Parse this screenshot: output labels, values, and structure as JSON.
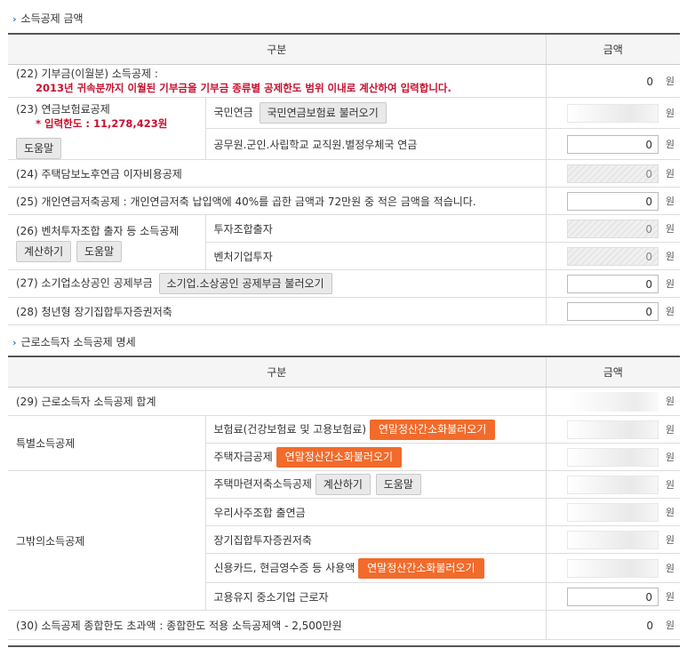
{
  "section1": {
    "title": "소득공제 금액",
    "col_label": "구분",
    "col_amount": "금액",
    "unit": "원",
    "r22": {
      "label": "(22) 기부금(이월분) 소득공제 :",
      "note": "2013년 귀속분까지 이월된 기부금을 기부금 종류별 공제한도 범위 이내로 계산하여 입력합니다.",
      "value": "0"
    },
    "r23": {
      "label": "(23) 연금보험료공제",
      "limit": "* 입력한도 : 11,278,423원",
      "help": "도움말",
      "sub1": "국민연금",
      "sub1_btn": "국민연금보험료 불러오기",
      "sub2": "공무원.군인.사립학교 교직원.별정우체국 연금",
      "sub2_value": "0"
    },
    "r24": {
      "label": "(24) 주택담보노후연금 이자비용공제",
      "value": "0"
    },
    "r25": {
      "label": "(25) 개인연금저축공제 : 개인연금저축 납입액에 40%를 곱한 금액과 72만원 중 적은 금액을 적습니다.",
      "value": "0"
    },
    "r26": {
      "label": "(26) 벤처투자조합 출자 등 소득공제",
      "calc": "계산하기",
      "help": "도움말",
      "sub1": "투자조합출자",
      "sub1_value": "0",
      "sub2": "벤처기업투자",
      "sub2_value": "0"
    },
    "r27": {
      "label": "(27) 소기업소상공인 공제부금",
      "btn": "소기업.소상공인 공제부금 불러오기",
      "value": "0"
    },
    "r28": {
      "label": "(28) 청년형 장기집합투자증권저축",
      "value": "0"
    }
  },
  "section2": {
    "title": "근로소득자 소득공제 명세",
    "col_label": "구분",
    "col_amount": "금액",
    "unit": "원",
    "r29": {
      "label": "(29) 근로소득자 소득공제 합계"
    },
    "special": {
      "label": "특별소득공제",
      "sub1": "보험료(건강보험료 및 고용보험료)",
      "sub1_btn": "연말정산간소화불러오기",
      "sub2": "주택자금공제",
      "sub2_btn": "연말정산간소화불러오기"
    },
    "other": {
      "label": "그밖의소득공제",
      "sub1": "주택마련저축소득공제",
      "calc": "계산하기",
      "help": "도움말",
      "sub2": "우리사주조합 출연금",
      "sub3": "장기집합투자증권저축",
      "sub4": "신용카드, 현금영수증 등 사용액",
      "sub4_btn": "연말정산간소화불러오기",
      "sub5": "고용유지 중소기업 근로자",
      "sub5_value": "0"
    },
    "r30": {
      "label": "(30) 소득공제 종합한도 초과액 : 종합한도 적용 소득공제액 - 2,500만원",
      "value": "0"
    }
  }
}
